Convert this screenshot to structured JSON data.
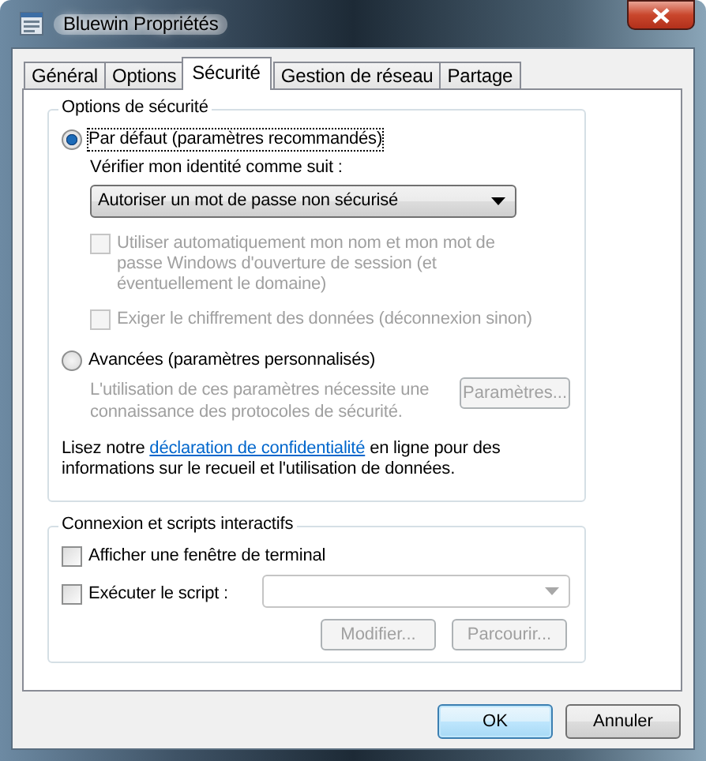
{
  "window": {
    "title": "Bluewin Propriétés"
  },
  "tabs": [
    {
      "label": "Général",
      "selected": false
    },
    {
      "label": "Options",
      "selected": false
    },
    {
      "label": "Sécurité",
      "selected": true
    },
    {
      "label": "Gestion de réseau",
      "selected": false
    },
    {
      "label": "Partage",
      "selected": false
    }
  ],
  "security_group": {
    "title": "Options de sécurité",
    "default_option": {
      "label": "Par défaut (paramètres recommandés)",
      "selected": true
    },
    "verify_label": "Vérifier mon identité comme suit :",
    "verify_select": {
      "value": "Autoriser un mot de passe non sécurisé"
    },
    "checkboxes": [
      {
        "label": "Utiliser automatiquement mon nom et mon mot de passe Windows d'ouverture de session (et éventuellement le domaine)",
        "checked": false,
        "disabled": true
      },
      {
        "label": "Exiger le chiffrement des données (déconnexion sinon)",
        "checked": false,
        "disabled": true
      }
    ],
    "advanced_option": {
      "label": "Avancées (paramètres personnalisés)",
      "selected": false
    },
    "advanced_note": {
      "text": "L'utilisation de ces paramètres nécessite une connaissance des protocoles de sécurité.",
      "disabled": true
    },
    "settings_button": {
      "label": "Paramètres...",
      "disabled": true
    },
    "privacy": {
      "before": "Lisez notre ",
      "link": "déclaration de confidentialité",
      "after": " en ligne pour des informations sur le recueil et l'utilisation de données."
    }
  },
  "connection_group": {
    "title": "Connexion et scripts interactifs",
    "checkboxes": [
      {
        "label": "Afficher une fenêtre de terminal",
        "checked": false,
        "disabled": false
      },
      {
        "label": "Exécuter le script :",
        "checked": false,
        "disabled": false
      }
    ],
    "script_select": {
      "disabled": true
    },
    "buttons": [
      {
        "label": "Modifier...",
        "disabled": true
      },
      {
        "label": "Parcourir...",
        "disabled": true
      }
    ]
  },
  "footer_buttons": [
    {
      "label": "OK",
      "default": true
    },
    {
      "label": "Annuler",
      "default": false
    }
  ]
}
